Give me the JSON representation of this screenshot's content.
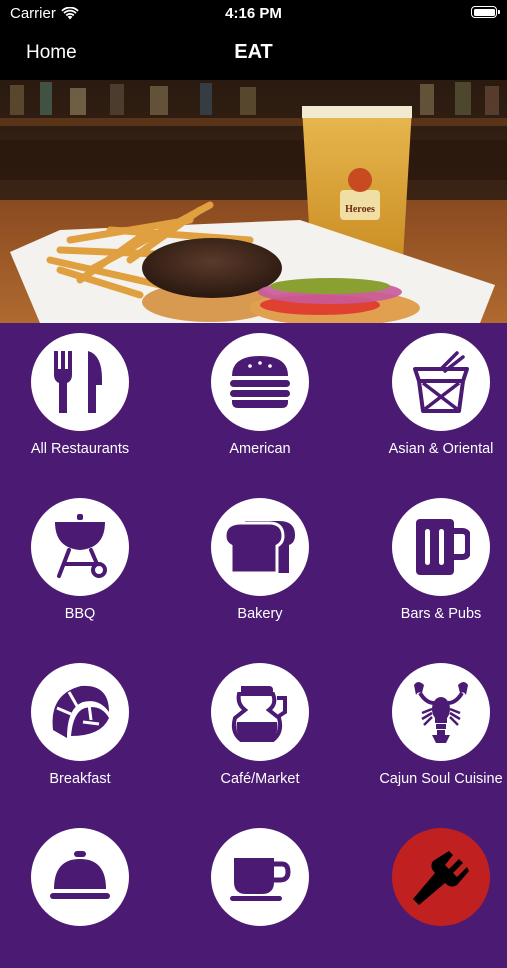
{
  "status_bar": {
    "carrier": "Carrier",
    "time": "4:16 PM"
  },
  "nav": {
    "back_label": "Home",
    "title": "EAT"
  },
  "hero": {
    "glass_logo_text": "Heroes"
  },
  "colors": {
    "background": "#4b1a73",
    "icon": "#4b1a73",
    "accent_red": "#c0201f"
  },
  "categories": [
    {
      "label": "All Restaurants",
      "icon": "fork-knife-icon"
    },
    {
      "label": "American",
      "icon": "burger-icon"
    },
    {
      "label": "Asian & Oriental",
      "icon": "takeout-box-icon"
    },
    {
      "label": "BBQ",
      "icon": "grill-icon"
    },
    {
      "label": "Bakery",
      "icon": "bread-icon"
    },
    {
      "label": "Bars & Pubs",
      "icon": "beer-mug-icon"
    },
    {
      "label": "Breakfast",
      "icon": "croissant-icon"
    },
    {
      "label": "Café/Market",
      "icon": "coffee-pot-icon"
    },
    {
      "label": "Cajun Soul Cuisine",
      "icon": "crawfish-icon"
    },
    {
      "label": "",
      "icon": "cloche-icon"
    },
    {
      "label": "",
      "icon": "coffee-cup-icon"
    },
    {
      "label": "",
      "icon": "fork-icon"
    }
  ]
}
